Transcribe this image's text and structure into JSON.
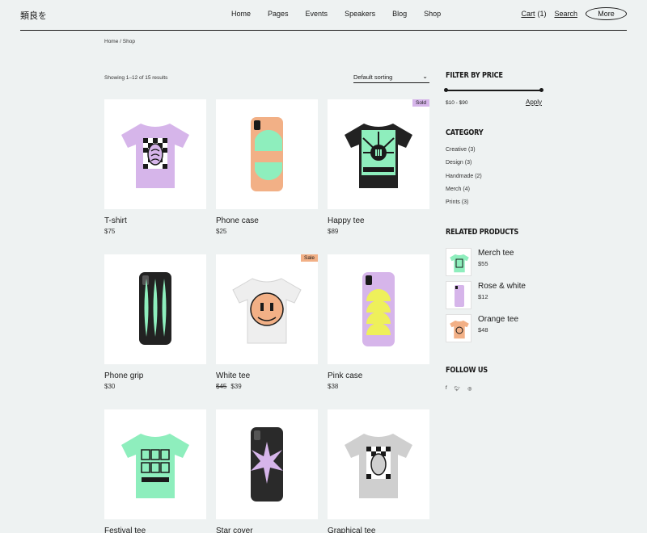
{
  "header": {
    "logo": "類良を",
    "nav": [
      "Home",
      "Pages",
      "Events",
      "Speakers",
      "Blog",
      "Shop"
    ],
    "cart_label": "Cart",
    "cart_count": "(1)",
    "search_label": "Search",
    "more_label": "More"
  },
  "breadcrumb": "Home / Shop",
  "results_text": "Showing 1–12 of 15 results",
  "sorting": {
    "selected": "Default sorting"
  },
  "products": [
    {
      "name": "T-shirt",
      "price": "$75"
    },
    {
      "name": "Phone case",
      "price": "$25"
    },
    {
      "name": "Happy tee",
      "price": "$89",
      "badge": "Sold"
    },
    {
      "name": "Phone grip",
      "price": "$30"
    },
    {
      "name": "White tee",
      "old_price": "$45",
      "price": "$39",
      "badge": "Sale"
    },
    {
      "name": "Pink case",
      "price": "$38"
    },
    {
      "name": "Festival tee",
      "price": ""
    },
    {
      "name": "Star cover",
      "price": ""
    },
    {
      "name": "Graphical tee",
      "price": ""
    }
  ],
  "sidebar": {
    "filter_title": "FILTER BY PRICE",
    "price_range": "$10 - $90",
    "apply_label": "Apply",
    "category_title": "CATEGORY",
    "categories": [
      "Creative (3)",
      "Design (3)",
      "Handmade (2)",
      "Merch (4)",
      "Prints (3)"
    ],
    "related_title": "RELATED PRODUCTS",
    "related": [
      {
        "name": "Merch tee",
        "price": "$55"
      },
      {
        "name": "Rose & white",
        "price": "$12"
      },
      {
        "name": "Orange tee",
        "price": "$48"
      }
    ],
    "follow_title": "FOLLOW US",
    "social_icons": [
      "facebook-icon",
      "twitter-icon",
      "instagram-icon"
    ]
  },
  "colors": {
    "background": "#eef2f2",
    "lavender": "#d6b5ea",
    "mint": "#8eeebd",
    "peach": "#f2b086",
    "yellow": "#eef05a",
    "black": "#1a1a1a"
  }
}
